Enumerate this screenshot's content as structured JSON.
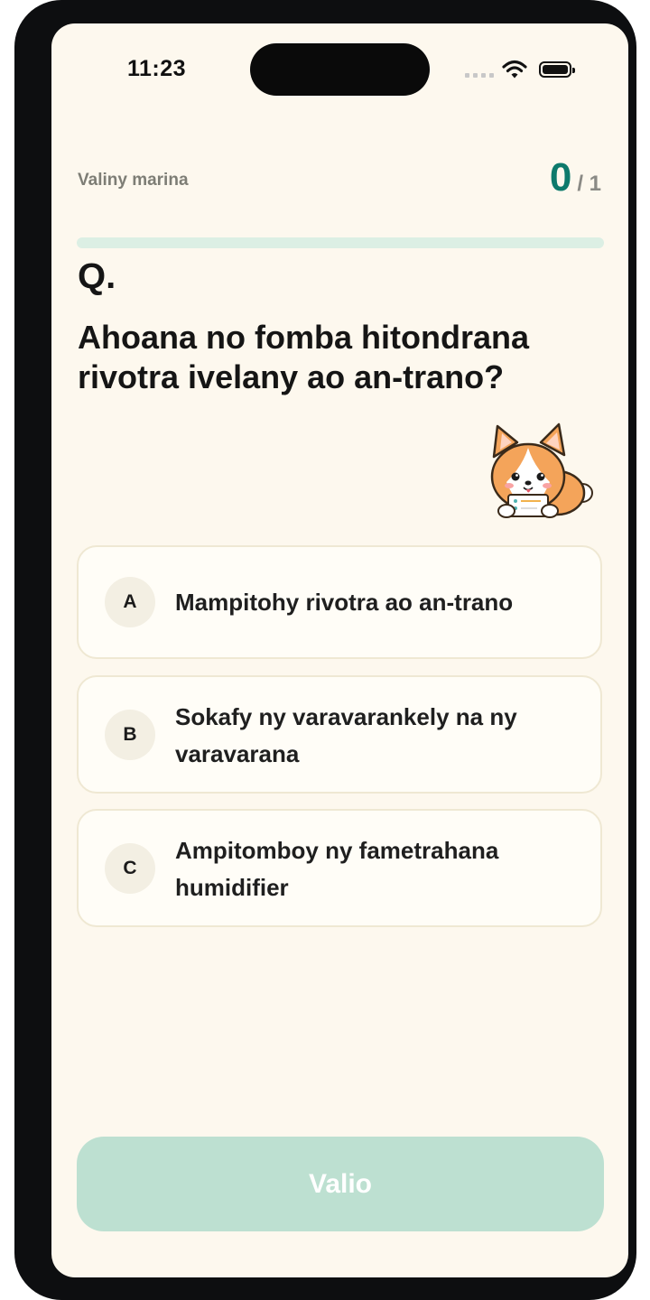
{
  "status_bar": {
    "time": "11:23",
    "icons": [
      "signal-icon",
      "wifi-icon",
      "battery-icon"
    ]
  },
  "header": {
    "label": "Valiny marina",
    "score_current": "0",
    "score_total": "/ 1",
    "progress_fraction": 0
  },
  "question": {
    "marker": "Q.",
    "text": "Ahoana no fomba hitondrana rivotra ivelany ao an-trano?"
  },
  "mascot": {
    "icon": "corgi-mascot-icon"
  },
  "options": [
    {
      "letter": "A",
      "text": "Mampitohy rivotra ao an-trano"
    },
    {
      "letter": "B",
      "text": "Sokafy ny varavarankely na ny varavarana"
    },
    {
      "letter": "C",
      "text": "Ampitomboy ny fametrahana humidifier"
    }
  ],
  "submit": {
    "label": "Valio"
  },
  "colors": {
    "accent": "#0d7a6c",
    "background": "#fdf8ee",
    "button_disabled": "#bde0d1",
    "progress_track": "#dcefe4"
  }
}
